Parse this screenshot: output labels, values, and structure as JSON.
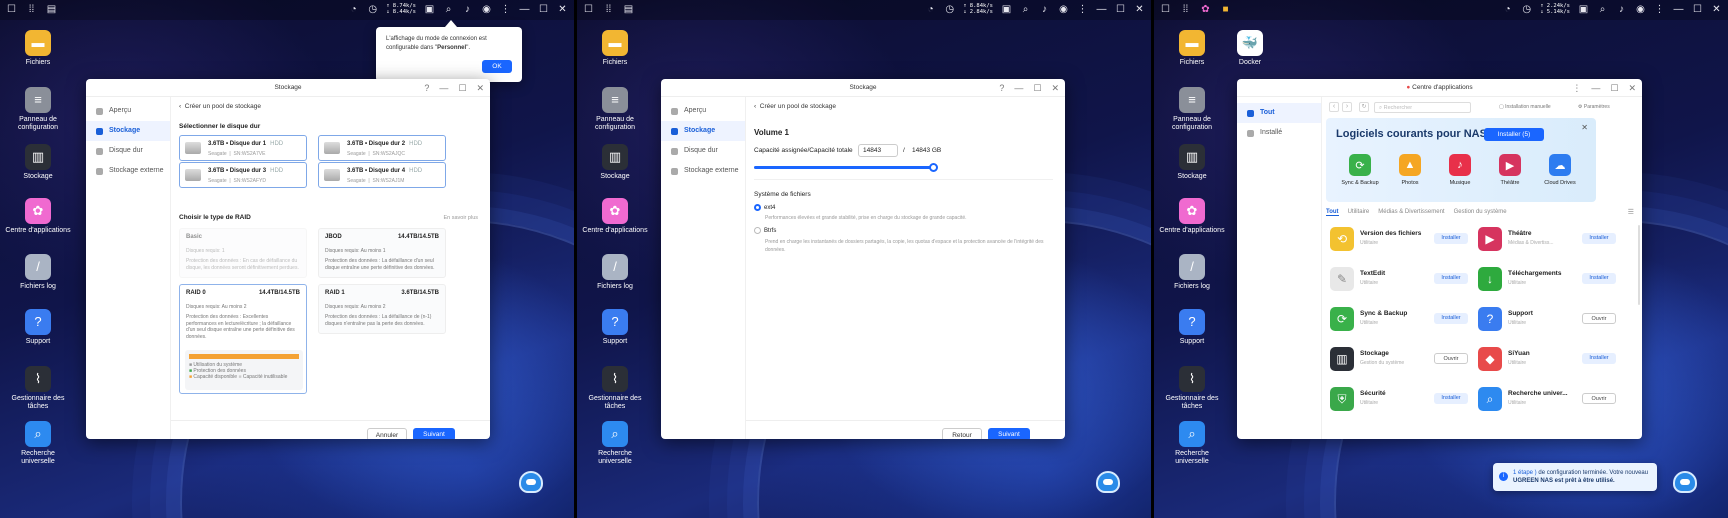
{
  "desktop": {
    "icons": [
      {
        "label": "Fichiers",
        "icon": "folder-icon",
        "color": "#f2b632"
      },
      {
        "label": "Panneau de configuration",
        "icon": "control-panel-icon",
        "color": "#8a8f99"
      },
      {
        "label": "Stockage",
        "icon": "storage-icon",
        "color": "#2b2f37"
      },
      {
        "label": "Centre d'applications",
        "icon": "app-center-icon",
        "color": "#f06ad0"
      },
      {
        "label": "Fichiers log",
        "icon": "logs-icon",
        "color": "#aab4c4"
      },
      {
        "label": "Support",
        "icon": "support-icon",
        "color": "#3a7cf0"
      },
      {
        "label": "Gestionnaire des tâches",
        "icon": "task-manager-icon",
        "color": "#2b2f37"
      },
      {
        "label": "Recherche universelle",
        "icon": "search-icon",
        "color": "#2d8af0"
      }
    ],
    "docker_label": "Docker",
    "speed_up": "↑ 8.74k/s",
    "speed_down": "↓ 8.44k/s",
    "speed_up_2": "↑ 8.84k/s",
    "speed_down_2": "↓ 2.84k/s",
    "speed_up_3": "↑ 2.24k/s",
    "speed_down_3": "↓ 5.14k/s"
  },
  "popup": {
    "text_a": "L'affichage du mode de connexion est configurable dans \"",
    "text_b": "Personnel",
    "text_c": "\".",
    "ok": "OK"
  },
  "screen1": {
    "title": "Stockage",
    "sidebar": [
      "Aperçu",
      "Stockage",
      "Disque dur",
      "Stockage externe"
    ],
    "breadcrumb": "Créer un pool de stockage",
    "section_disk": "Sélectionner le disque dur",
    "disks": [
      {
        "name": "3.6TB • Disque dur 1",
        "type": "HDD",
        "vendor": "Seagate",
        "sn": "SN:WS2A7VE"
      },
      {
        "name": "3.6TB • Disque dur 2",
        "type": "HDD",
        "vendor": "Seagate",
        "sn": "SN:WS2AJQC"
      },
      {
        "name": "3.6TB • Disque dur 3",
        "type": "HDD",
        "vendor": "Seagate",
        "sn": "SN:WS2AFYD"
      },
      {
        "name": "3.6TB • Disque dur 4",
        "type": "HDD",
        "vendor": "Seagate",
        "sn": "SN:WS2AJ1M"
      }
    ],
    "section_raid": "Choisir le type de RAID",
    "learn_more": "En savoir plus",
    "raids": [
      {
        "name": "Basic",
        "cap": "",
        "req": "Disques requis: 1",
        "desc": "Protection des données : En cas de défaillance du disque, les données seront définitivement perdues."
      },
      {
        "name": "JBOD",
        "cap": "14.4TB/14.5TB",
        "req": "Disques requis: Au moins 1",
        "desc": "Protection des données : La défaillance d'un seul disque entraîne une perte définitive des données."
      },
      {
        "name": "RAID 0",
        "cap": "14.4TB/14.5TB",
        "req": "Disques requis: Au moins 2",
        "desc": "Protection des données : Excellentes performances en lecture/écriture ; la défaillance d'un seul disque entraîne une perte définitive des données."
      },
      {
        "name": "RAID 1",
        "cap": "3.6TB/14.5TB",
        "req": "Disques requis: Au moins 2",
        "desc": "Protection des données : La défaillance de (n-1) disques n'entraîne pas la perte des données."
      }
    ],
    "legend": [
      "Utilisation du système",
      "Protection des données",
      "Capacité disponible",
      "Capacité inutilisable"
    ],
    "cancel": "Annuler",
    "next": "Suivant"
  },
  "screen2": {
    "title": "Stockage",
    "sidebar": [
      "Aperçu",
      "Stockage",
      "Disque dur",
      "Stockage externe"
    ],
    "breadcrumb": "Créer un pool de stockage",
    "volume": "Volume 1",
    "cap_label": "Capacité assignée/Capacité totale",
    "cap_value": "14843",
    "cap_sep": "/",
    "cap_total": "14843 GB",
    "slider_fraction": 1.0,
    "fs_label": "Système de fichiers",
    "fs": [
      {
        "name": "ext4",
        "desc": "Performances élevées et grande stabilité, prise en charge du stockage de grande capacité."
      },
      {
        "name": "Btrfs",
        "desc": "Prend en charge les instantanés de dossiers partagés, la copie, les quotas d'espace et la protection avancée de l'intégrité des données."
      }
    ],
    "back": "Retour",
    "next": "Suivant"
  },
  "screen3": {
    "title": "Centre d'applications",
    "sidebar": [
      "Tout",
      "Installé"
    ],
    "search_placeholder": "Rechercher",
    "manual_install": "Installation manuelle",
    "settings": "Paramètres",
    "banner_title": "Logiciels courants pour NAS",
    "banner_btn": "Installer (5)",
    "banner_apps": [
      {
        "name": "Sync & Backup",
        "color": "#39b14a"
      },
      {
        "name": "Photos",
        "color": "#f5a623"
      },
      {
        "name": "Musique",
        "color": "#e8304a"
      },
      {
        "name": "Théâtre",
        "color": "#d6345f"
      },
      {
        "name": "Cloud Drives",
        "color": "#2d7cf0"
      }
    ],
    "tabs": [
      "Tout",
      "Utilitaire",
      "Médias & Divertissement",
      "Gestion du système"
    ],
    "apps": [
      {
        "name": "Version des fichiers",
        "sub": "Utilitaire",
        "btn": "Installer",
        "kind": "inst",
        "color": "#f3c230"
      },
      {
        "name": "Théâtre",
        "sub": "Médias & Divertiss...",
        "btn": "Installer",
        "kind": "inst",
        "color": "#d6345f"
      },
      {
        "name": "TextEdit",
        "sub": "Utilitaire",
        "btn": "Installer",
        "kind": "inst",
        "color": "#e8e8e8"
      },
      {
        "name": "Téléchargements",
        "sub": "Utilitaire",
        "btn": "Installer",
        "kind": "inst",
        "color": "#2eaa3e"
      },
      {
        "name": "Sync & Backup",
        "sub": "Utilitaire",
        "btn": "Installer",
        "kind": "inst",
        "color": "#39b14a"
      },
      {
        "name": "Support",
        "sub": "Utilitaire",
        "btn": "Ouvrir",
        "kind": "open",
        "color": "#3a7cf0"
      },
      {
        "name": "Stockage",
        "sub": "Gestion du système",
        "btn": "Ouvrir",
        "kind": "open",
        "color": "#2b2f37"
      },
      {
        "name": "SiYuan",
        "sub": "Utilitaire",
        "btn": "Installer",
        "kind": "inst",
        "color": "#e84a4a"
      },
      {
        "name": "Sécurité",
        "sub": "Utilitaire",
        "btn": "Installer",
        "kind": "inst",
        "color": "#3aa84a"
      },
      {
        "name": "Recherche univer...",
        "sub": "Utilitaire",
        "btn": "Ouvrir",
        "kind": "open",
        "color": "#2d8af0"
      }
    ],
    "toast_a": "1 étape )",
    "toast_b": " de configuration terminée. Votre nouveau ",
    "toast_c": "UGREEN NAS est prêt à être utilisé."
  }
}
